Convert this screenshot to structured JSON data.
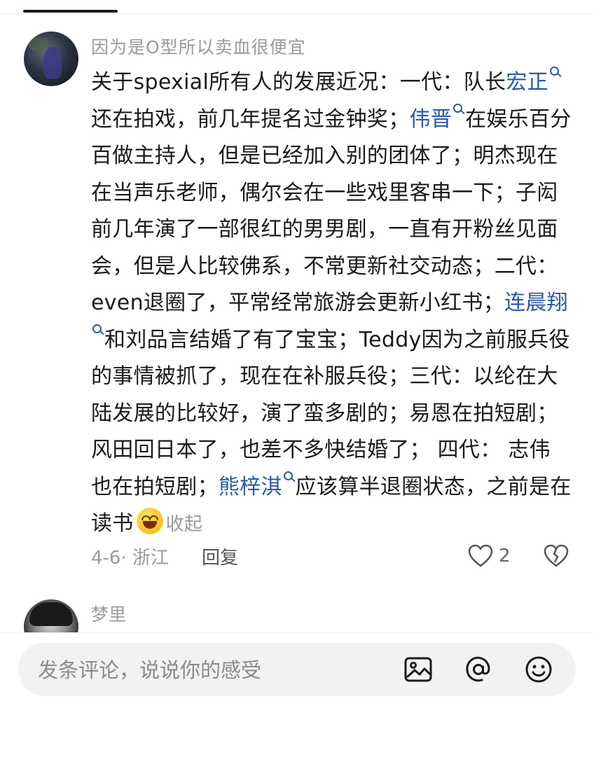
{
  "comment": {
    "username": "因为是O型所以卖血很便宜",
    "body": [
      {
        "t": "text",
        "v": "关于spexial所有人的发展近况：一代：队长"
      },
      {
        "t": "link",
        "v": "宏正"
      },
      {
        "t": "text",
        "v": "还在拍戏，前几年提名过金钟奖；"
      },
      {
        "t": "link",
        "v": "伟晋"
      },
      {
        "t": "text",
        "v": "在娱乐百分百做主持人，但是已经加入别的团体了；明杰现在在当声乐老师，偶尔会在一些戏里客串一下；子闳前几年演了一部很红的男男剧，一直有开粉丝见面会，但是人比较佛系，不常更新社交动态；二代：even退圈了，平常经常旅游会更新小红书；"
      },
      {
        "t": "link",
        "v": "连晨翔"
      },
      {
        "t": "text",
        "v": "和刘品言结婚了有了宝宝；Teddy因为之前服兵役的事情被抓了，现在在补服兵役；三代：以纶在大陆发展的比较好，演了蛮多剧的；易恩在拍短剧；风田回日本了，也差不多快结婚了；  四代：  志伟也在拍短剧；"
      },
      {
        "t": "link",
        "v": "熊梓淇"
      },
      {
        "t": "text",
        "v": "应该算半退圈状态，之前是在读书"
      },
      {
        "t": "emoji",
        "v": "smile"
      }
    ],
    "collapse_label": "收起",
    "meta": "4-6· 浙江",
    "reply_label": "回复",
    "like_count": "2"
  },
  "comment2": {
    "username": "梦里"
  },
  "composer": {
    "placeholder": "发条评论，说说你的感受",
    "icons": [
      "image-icon",
      "at-icon",
      "emoji-icon"
    ]
  },
  "colors": {
    "link": "#2a5aa3",
    "muted": "#9a9a9a",
    "text": "#1a1a1a",
    "pill": "#f2f2f2"
  }
}
